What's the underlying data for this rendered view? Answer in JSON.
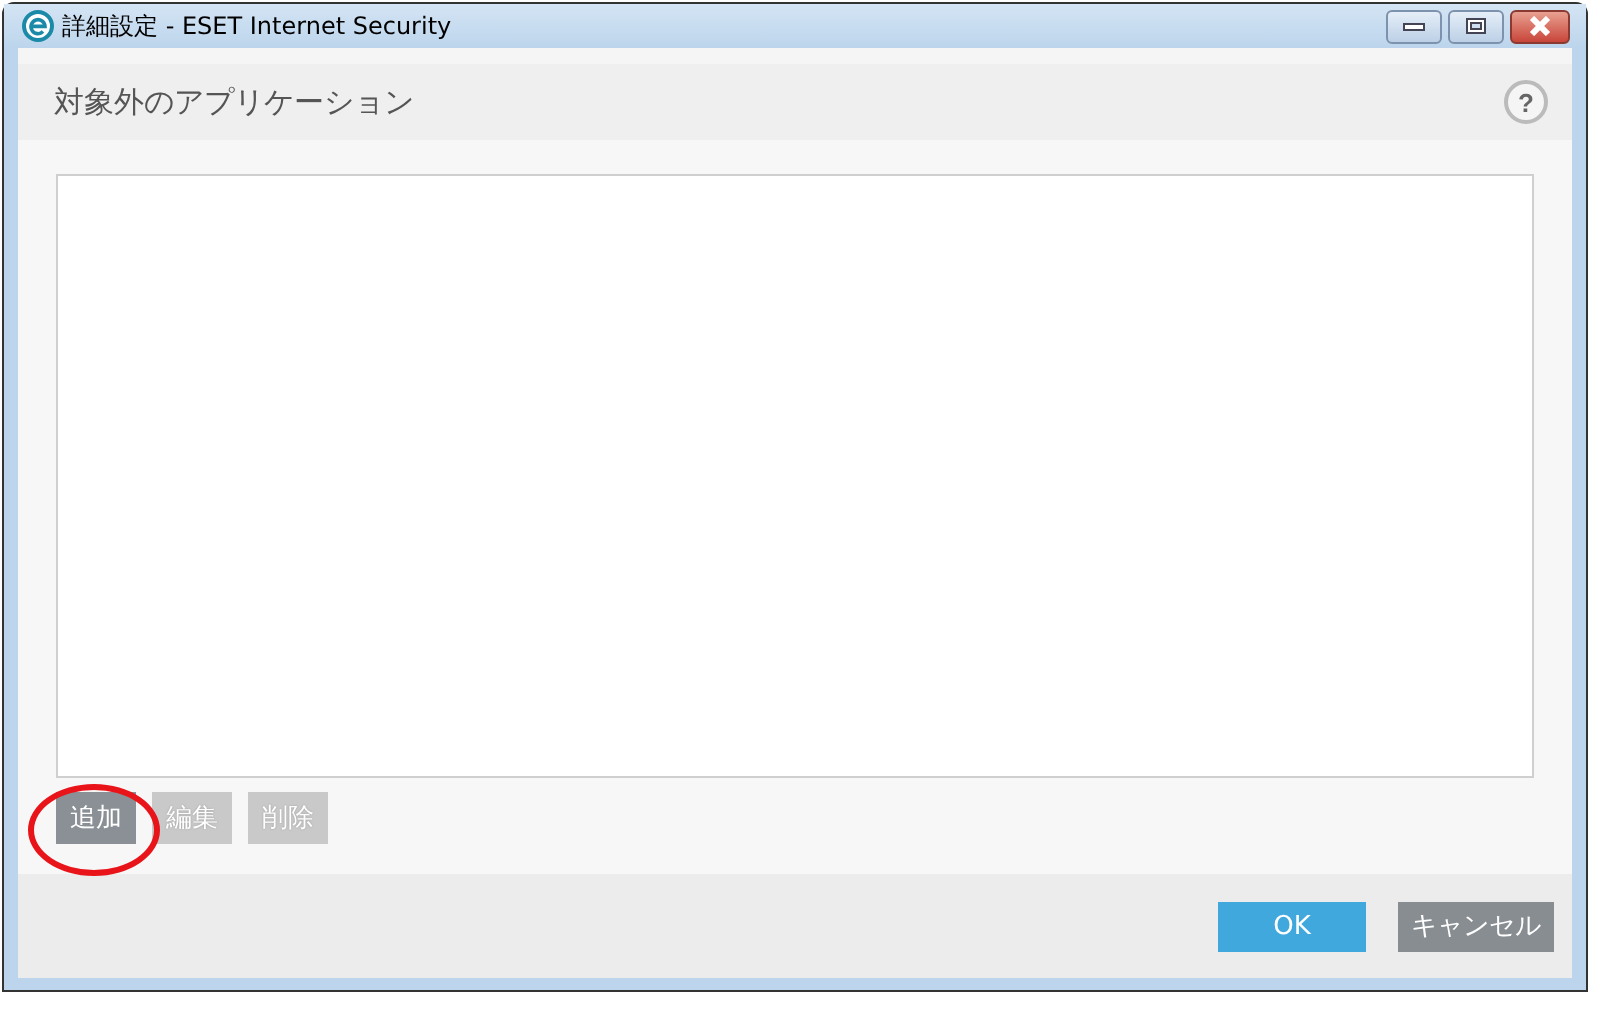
{
  "window": {
    "title": "詳細設定 - ESET Internet Security"
  },
  "header": {
    "title": "対象外のアプリケーション",
    "help": "?"
  },
  "list_buttons": [
    {
      "label": "追加",
      "disabled": false
    },
    {
      "label": "編集",
      "disabled": true
    },
    {
      "label": "削除",
      "disabled": true
    }
  ],
  "dialog_buttons": [
    {
      "label": "OK",
      "kind": "primary"
    },
    {
      "label": "キャンセル",
      "kind": "secondary"
    }
  ]
}
